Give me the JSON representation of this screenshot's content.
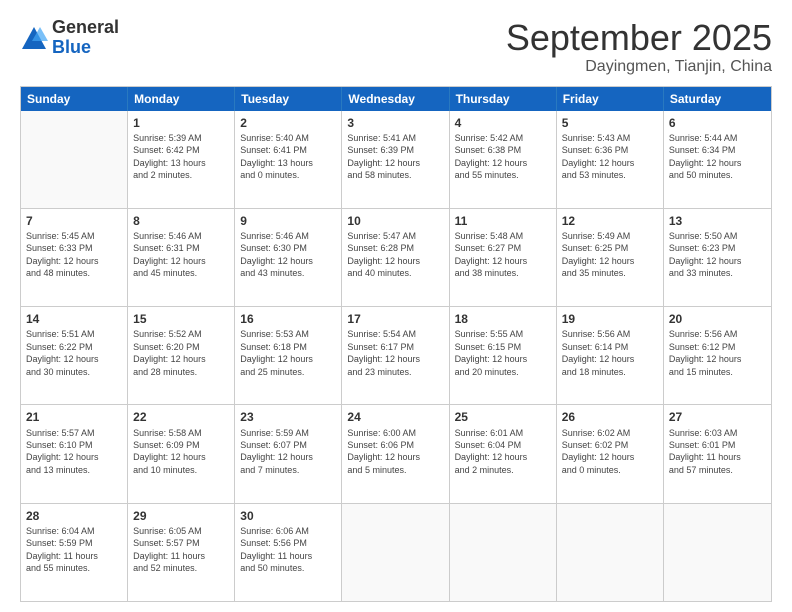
{
  "header": {
    "logo_general": "General",
    "logo_blue": "Blue",
    "month_title": "September 2025",
    "subtitle": "Dayingmen, Tianjin, China"
  },
  "weekdays": [
    "Sunday",
    "Monday",
    "Tuesday",
    "Wednesday",
    "Thursday",
    "Friday",
    "Saturday"
  ],
  "rows": [
    [
      {
        "day": "",
        "empty": true
      },
      {
        "day": "1",
        "lines": [
          "Sunrise: 5:39 AM",
          "Sunset: 6:42 PM",
          "Daylight: 13 hours",
          "and 2 minutes."
        ]
      },
      {
        "day": "2",
        "lines": [
          "Sunrise: 5:40 AM",
          "Sunset: 6:41 PM",
          "Daylight: 13 hours",
          "and 0 minutes."
        ]
      },
      {
        "day": "3",
        "lines": [
          "Sunrise: 5:41 AM",
          "Sunset: 6:39 PM",
          "Daylight: 12 hours",
          "and 58 minutes."
        ]
      },
      {
        "day": "4",
        "lines": [
          "Sunrise: 5:42 AM",
          "Sunset: 6:38 PM",
          "Daylight: 12 hours",
          "and 55 minutes."
        ]
      },
      {
        "day": "5",
        "lines": [
          "Sunrise: 5:43 AM",
          "Sunset: 6:36 PM",
          "Daylight: 12 hours",
          "and 53 minutes."
        ]
      },
      {
        "day": "6",
        "lines": [
          "Sunrise: 5:44 AM",
          "Sunset: 6:34 PM",
          "Daylight: 12 hours",
          "and 50 minutes."
        ]
      }
    ],
    [
      {
        "day": "7",
        "lines": [
          "Sunrise: 5:45 AM",
          "Sunset: 6:33 PM",
          "Daylight: 12 hours",
          "and 48 minutes."
        ]
      },
      {
        "day": "8",
        "lines": [
          "Sunrise: 5:46 AM",
          "Sunset: 6:31 PM",
          "Daylight: 12 hours",
          "and 45 minutes."
        ]
      },
      {
        "day": "9",
        "lines": [
          "Sunrise: 5:46 AM",
          "Sunset: 6:30 PM",
          "Daylight: 12 hours",
          "and 43 minutes."
        ]
      },
      {
        "day": "10",
        "lines": [
          "Sunrise: 5:47 AM",
          "Sunset: 6:28 PM",
          "Daylight: 12 hours",
          "and 40 minutes."
        ]
      },
      {
        "day": "11",
        "lines": [
          "Sunrise: 5:48 AM",
          "Sunset: 6:27 PM",
          "Daylight: 12 hours",
          "and 38 minutes."
        ]
      },
      {
        "day": "12",
        "lines": [
          "Sunrise: 5:49 AM",
          "Sunset: 6:25 PM",
          "Daylight: 12 hours",
          "and 35 minutes."
        ]
      },
      {
        "day": "13",
        "lines": [
          "Sunrise: 5:50 AM",
          "Sunset: 6:23 PM",
          "Daylight: 12 hours",
          "and 33 minutes."
        ]
      }
    ],
    [
      {
        "day": "14",
        "lines": [
          "Sunrise: 5:51 AM",
          "Sunset: 6:22 PM",
          "Daylight: 12 hours",
          "and 30 minutes."
        ]
      },
      {
        "day": "15",
        "lines": [
          "Sunrise: 5:52 AM",
          "Sunset: 6:20 PM",
          "Daylight: 12 hours",
          "and 28 minutes."
        ]
      },
      {
        "day": "16",
        "lines": [
          "Sunrise: 5:53 AM",
          "Sunset: 6:18 PM",
          "Daylight: 12 hours",
          "and 25 minutes."
        ]
      },
      {
        "day": "17",
        "lines": [
          "Sunrise: 5:54 AM",
          "Sunset: 6:17 PM",
          "Daylight: 12 hours",
          "and 23 minutes."
        ]
      },
      {
        "day": "18",
        "lines": [
          "Sunrise: 5:55 AM",
          "Sunset: 6:15 PM",
          "Daylight: 12 hours",
          "and 20 minutes."
        ]
      },
      {
        "day": "19",
        "lines": [
          "Sunrise: 5:56 AM",
          "Sunset: 6:14 PM",
          "Daylight: 12 hours",
          "and 18 minutes."
        ]
      },
      {
        "day": "20",
        "lines": [
          "Sunrise: 5:56 AM",
          "Sunset: 6:12 PM",
          "Daylight: 12 hours",
          "and 15 minutes."
        ]
      }
    ],
    [
      {
        "day": "21",
        "lines": [
          "Sunrise: 5:57 AM",
          "Sunset: 6:10 PM",
          "Daylight: 12 hours",
          "and 13 minutes."
        ]
      },
      {
        "day": "22",
        "lines": [
          "Sunrise: 5:58 AM",
          "Sunset: 6:09 PM",
          "Daylight: 12 hours",
          "and 10 minutes."
        ]
      },
      {
        "day": "23",
        "lines": [
          "Sunrise: 5:59 AM",
          "Sunset: 6:07 PM",
          "Daylight: 12 hours",
          "and 7 minutes."
        ]
      },
      {
        "day": "24",
        "lines": [
          "Sunrise: 6:00 AM",
          "Sunset: 6:06 PM",
          "Daylight: 12 hours",
          "and 5 minutes."
        ]
      },
      {
        "day": "25",
        "lines": [
          "Sunrise: 6:01 AM",
          "Sunset: 6:04 PM",
          "Daylight: 12 hours",
          "and 2 minutes."
        ]
      },
      {
        "day": "26",
        "lines": [
          "Sunrise: 6:02 AM",
          "Sunset: 6:02 PM",
          "Daylight: 12 hours",
          "and 0 minutes."
        ]
      },
      {
        "day": "27",
        "lines": [
          "Sunrise: 6:03 AM",
          "Sunset: 6:01 PM",
          "Daylight: 11 hours",
          "and 57 minutes."
        ]
      }
    ],
    [
      {
        "day": "28",
        "lines": [
          "Sunrise: 6:04 AM",
          "Sunset: 5:59 PM",
          "Daylight: 11 hours",
          "and 55 minutes."
        ]
      },
      {
        "day": "29",
        "lines": [
          "Sunrise: 6:05 AM",
          "Sunset: 5:57 PM",
          "Daylight: 11 hours",
          "and 52 minutes."
        ]
      },
      {
        "day": "30",
        "lines": [
          "Sunrise: 6:06 AM",
          "Sunset: 5:56 PM",
          "Daylight: 11 hours",
          "and 50 minutes."
        ]
      },
      {
        "day": "",
        "empty": true
      },
      {
        "day": "",
        "empty": true
      },
      {
        "day": "",
        "empty": true
      },
      {
        "day": "",
        "empty": true
      }
    ]
  ]
}
